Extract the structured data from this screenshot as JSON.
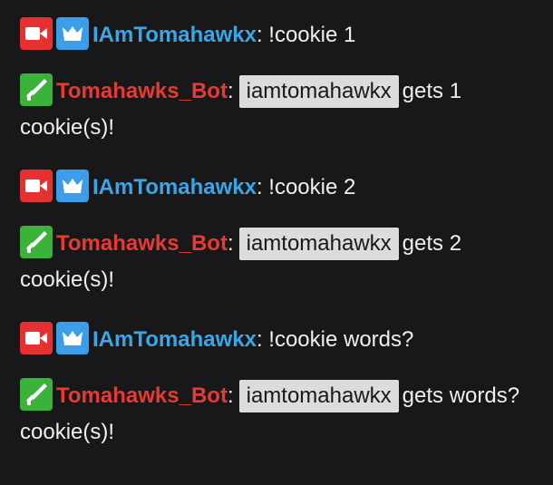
{
  "messages": [
    {
      "author": "IAmTomahawkx",
      "sep": ":",
      "text": " !cookie 1"
    },
    {
      "author": "Tomahawks_Bot",
      "sep": ":",
      "mention": "iamtomahawkx",
      "text": "gets 1 cookie(s)!"
    },
    {
      "author": "IAmTomahawkx",
      "sep": ":",
      "text": " !cookie 2"
    },
    {
      "author": "Tomahawks_Bot",
      "sep": ":",
      "mention": "iamtomahawkx",
      "text": "gets 2 cookie(s)!"
    },
    {
      "author": "IAmTomahawkx",
      "sep": ":",
      "text": " !cookie words?"
    },
    {
      "author": "Tomahawks_Bot",
      "sep": ":",
      "mention": "iamtomahawkx",
      "text": "gets words? cookie(s)!"
    }
  ],
  "badges": {
    "broadcaster": "video-camera-icon",
    "vip": "crown-icon",
    "moderator": "sword-icon"
  },
  "colors": {
    "background": "#18181b",
    "streamer_name": "#38a7e8",
    "bot_name": "#e63a33",
    "broadcaster_badge": "#e5312f",
    "vip_badge": "#3c9ee8",
    "moderator_badge": "#3bb33b",
    "mention_bg": "#dcdcdc"
  }
}
